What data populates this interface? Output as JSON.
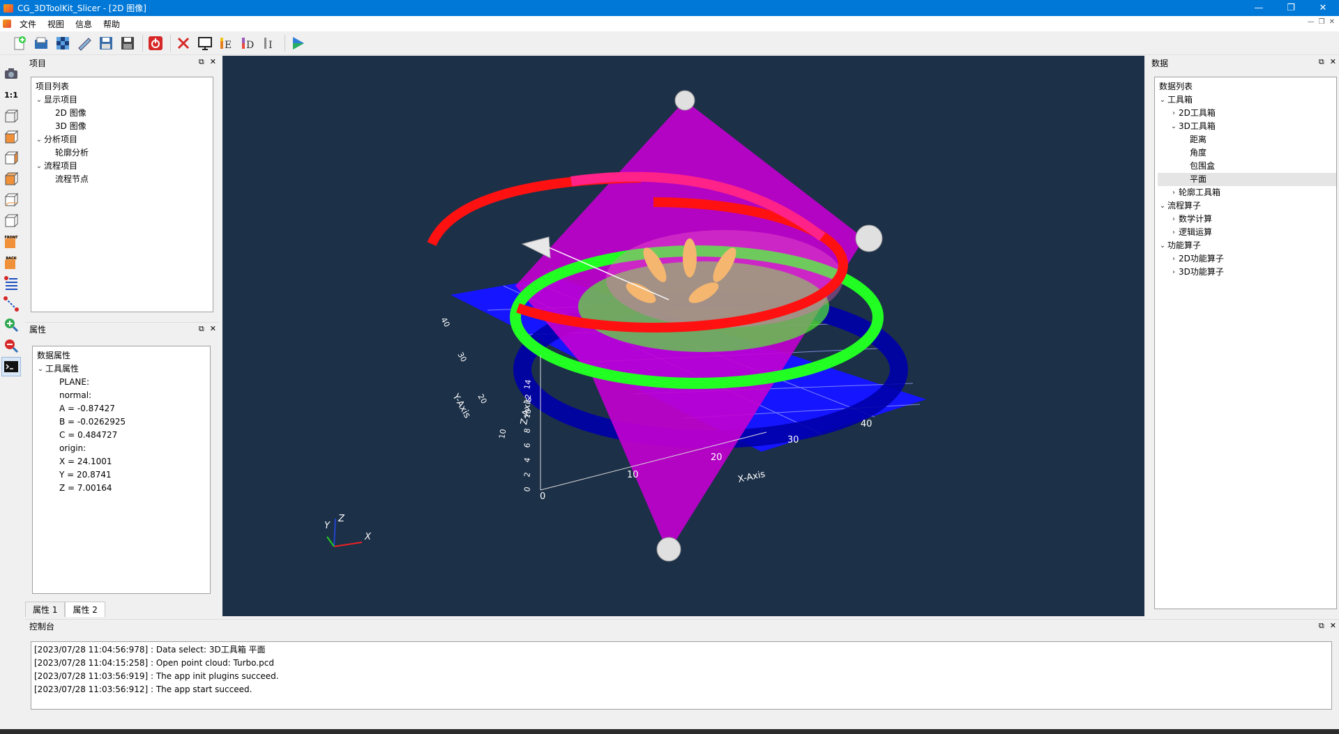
{
  "window": {
    "title": "CG_3DToolKit_Slicer - [2D 图像]",
    "min": "—",
    "max": "❐",
    "close": "✕"
  },
  "menu": [
    "文件",
    "视图",
    "信息",
    "帮助"
  ],
  "project_panel": {
    "title": "项目",
    "tree_header": "项目列表",
    "items": [
      {
        "label": "显示项目",
        "level": 0,
        "arrow": "⌄"
      },
      {
        "label": "2D  图像",
        "level": 1,
        "arrow": ""
      },
      {
        "label": "3D  图像",
        "level": 1,
        "arrow": ""
      },
      {
        "label": "分析项目",
        "level": 0,
        "arrow": "⌄"
      },
      {
        "label": "轮廓分析",
        "level": 1,
        "arrow": ""
      },
      {
        "label": "流程项目",
        "level": 0,
        "arrow": "⌄"
      },
      {
        "label": "流程节点",
        "level": 1,
        "arrow": ""
      }
    ]
  },
  "property_panel": {
    "title": "属性",
    "tree_header": "数据属性",
    "group": "工具属性",
    "lines": [
      "PLANE:",
      "normal:",
      "A = -0.87427",
      "B = -0.0262925",
      "C = 0.484727",
      "origin:",
      "X = 24.1001",
      "Y = 20.8741",
      "Z = 7.00164"
    ],
    "tabs": [
      "属性 1",
      "属性 2"
    ]
  },
  "data_panel": {
    "title": "数据",
    "tree_header": "数据列表",
    "items": [
      {
        "label": "工具箱",
        "level": 0,
        "arrow": "⌄",
        "selected": false
      },
      {
        "label": "2D工具箱",
        "level": 1,
        "arrow": "›",
        "selected": false
      },
      {
        "label": "3D工具箱",
        "level": 1,
        "arrow": "⌄",
        "selected": false
      },
      {
        "label": "距离",
        "level": 2,
        "arrow": "",
        "selected": false
      },
      {
        "label": "角度",
        "level": 2,
        "arrow": "",
        "selected": false
      },
      {
        "label": "包围盒",
        "level": 2,
        "arrow": "",
        "selected": false
      },
      {
        "label": "平面",
        "level": 2,
        "arrow": "",
        "selected": true
      },
      {
        "label": "轮廓工具箱",
        "level": 1,
        "arrow": "›",
        "selected": false
      },
      {
        "label": "流程算子",
        "level": 0,
        "arrow": "⌄",
        "selected": false
      },
      {
        "label": "数学计算",
        "level": 1,
        "arrow": "›",
        "selected": false
      },
      {
        "label": "逻辑运算",
        "level": 1,
        "arrow": "›",
        "selected": false
      },
      {
        "label": "功能算子",
        "level": 0,
        "arrow": "⌄",
        "selected": false
      },
      {
        "label": "2D功能算子",
        "level": 1,
        "arrow": "›",
        "selected": false
      },
      {
        "label": "3D功能算子",
        "level": 1,
        "arrow": "›",
        "selected": false
      }
    ]
  },
  "viewport": {
    "x_axis": "X-Axis",
    "y_axis": "Y-Axis",
    "z_axis": "Z-Axis",
    "x_ticks": [
      "10",
      "20",
      "30",
      "40"
    ],
    "y_ticks": [
      "10",
      "20",
      "30",
      "40"
    ],
    "z_ticks": [
      "0",
      "2",
      "4",
      "6",
      "8",
      "10",
      "12",
      "14"
    ],
    "origin_label": "0",
    "axes_widget": {
      "x": "X",
      "y": "Y",
      "z": "Z"
    }
  },
  "console": {
    "title": "控制台",
    "lines": [
      "[2023/07/28 11:04:56:978] : Data select: 3D工具箱  平面",
      "[2023/07/28 11:04:15:258] : Open point cloud: Turbo.pcd",
      "[2023/07/28 11:03:56:919] : The app init plugins succeed.",
      "[2023/07/28 11:03:56:912] : The app start succeed."
    ]
  },
  "left_toolbar": {
    "ratio_label": "1:1",
    "front_label": "FRONT",
    "back_label": "BACK"
  },
  "toolbar_icons": [
    "new-file-icon",
    "open-file-icon",
    "checker-icon",
    "edit-icon",
    "save-icon",
    "save-as-icon",
    "power-icon",
    "delete-icon",
    "screen-icon",
    "e-icon",
    "d-icon",
    "i-icon",
    "run-icon"
  ],
  "dock_buttons": {
    "float": "⧉",
    "close": "✕"
  },
  "colors": {
    "titlebar": "#0078d7",
    "viewport_bg": "#1c3048",
    "plane": "#c400d0",
    "grid": "#1010ff"
  }
}
